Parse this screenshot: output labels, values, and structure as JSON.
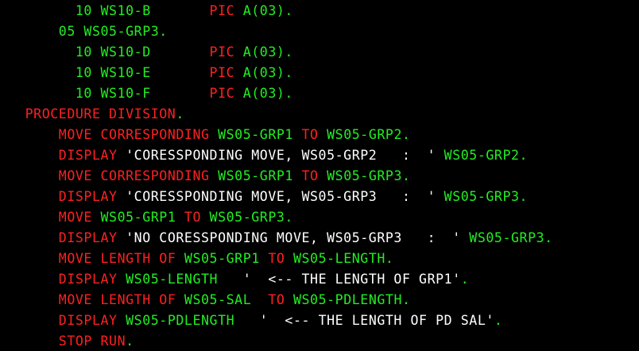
{
  "colors": {
    "background": "#000000",
    "keyword": "#ff2020",
    "identifier": "#22ee22",
    "literal": "#ffffff"
  },
  "lines": [
    {
      "indent": "         ",
      "tokens": [
        {
          "t": "10 WS10-B",
          "c": "id"
        },
        {
          "t": "       ",
          "c": "id"
        },
        {
          "t": "PIC",
          "c": "kw"
        },
        {
          "t": " ",
          "c": "id"
        },
        {
          "t": "A(03).",
          "c": "id"
        }
      ]
    },
    {
      "indent": "       ",
      "tokens": [
        {
          "t": "05 WS05-GRP3.",
          "c": "id"
        }
      ]
    },
    {
      "indent": "         ",
      "tokens": [
        {
          "t": "10 WS10-D",
          "c": "id"
        },
        {
          "t": "       ",
          "c": "id"
        },
        {
          "t": "PIC",
          "c": "kw"
        },
        {
          "t": " ",
          "c": "id"
        },
        {
          "t": "A(03).",
          "c": "id"
        }
      ]
    },
    {
      "indent": "         ",
      "tokens": [
        {
          "t": "10 WS10-E",
          "c": "id"
        },
        {
          "t": "       ",
          "c": "id"
        },
        {
          "t": "PIC",
          "c": "kw"
        },
        {
          "t": " ",
          "c": "id"
        },
        {
          "t": "A(03).",
          "c": "id"
        }
      ]
    },
    {
      "indent": "         ",
      "tokens": [
        {
          "t": "10 WS10-F",
          "c": "id"
        },
        {
          "t": "       ",
          "c": "id"
        },
        {
          "t": "PIC",
          "c": "kw"
        },
        {
          "t": " ",
          "c": "id"
        },
        {
          "t": "A(03).",
          "c": "id"
        }
      ]
    },
    {
      "indent": "   ",
      "tokens": [
        {
          "t": "PROCEDURE DIVISION",
          "c": "kw"
        },
        {
          "t": ".",
          "c": "id"
        }
      ]
    },
    {
      "indent": "       ",
      "tokens": [
        {
          "t": "MOVE CORRESPONDING",
          "c": "kw"
        },
        {
          "t": " WS05-GRP1 ",
          "c": "id"
        },
        {
          "t": "TO",
          "c": "kw"
        },
        {
          "t": " WS05-GRP2.",
          "c": "id"
        }
      ]
    },
    {
      "indent": "       ",
      "tokens": [
        {
          "t": "DISPLAY",
          "c": "kw"
        },
        {
          "t": " 'CORESSPONDING MOVE, WS05-GRP2   :  '",
          "c": "str"
        },
        {
          "t": " WS05-GRP2.",
          "c": "id"
        }
      ]
    },
    {
      "indent": "       ",
      "tokens": [
        {
          "t": "MOVE CORRESPONDING",
          "c": "kw"
        },
        {
          "t": " WS05-GRP1 ",
          "c": "id"
        },
        {
          "t": "TO",
          "c": "kw"
        },
        {
          "t": " WS05-GRP3.",
          "c": "id"
        }
      ]
    },
    {
      "indent": "       ",
      "tokens": [
        {
          "t": "DISPLAY",
          "c": "kw"
        },
        {
          "t": " 'CORESSPONDING MOVE, WS05-GRP3   :  '",
          "c": "str"
        },
        {
          "t": " WS05-GRP3.",
          "c": "id"
        }
      ]
    },
    {
      "indent": "       ",
      "tokens": [
        {
          "t": "MOVE",
          "c": "kw"
        },
        {
          "t": " WS05-GRP1 ",
          "c": "id"
        },
        {
          "t": "TO",
          "c": "kw"
        },
        {
          "t": " WS05-GRP3.",
          "c": "id"
        }
      ]
    },
    {
      "indent": "       ",
      "tokens": [
        {
          "t": "DISPLAY",
          "c": "kw"
        },
        {
          "t": " 'NO CORESSPONDING MOVE, WS05-GRP3   :  '",
          "c": "str"
        },
        {
          "t": " WS05-GRP3.",
          "c": "id"
        }
      ]
    },
    {
      "indent": "       ",
      "tokens": [
        {
          "t": "MOVE LENGTH OF",
          "c": "kw"
        },
        {
          "t": " WS05-GRP1 ",
          "c": "id"
        },
        {
          "t": "TO",
          "c": "kw"
        },
        {
          "t": " WS05-LENGTH.",
          "c": "id"
        }
      ]
    },
    {
      "indent": "       ",
      "tokens": [
        {
          "t": "DISPLAY",
          "c": "kw"
        },
        {
          "t": " WS05-LENGTH  ",
          "c": "id"
        },
        {
          "t": " '  <-- THE LENGTH OF GRP1'",
          "c": "str"
        },
        {
          "t": ".",
          "c": "id"
        }
      ]
    },
    {
      "indent": "       ",
      "tokens": [
        {
          "t": "MOVE LENGTH OF",
          "c": "kw"
        },
        {
          "t": " WS05-SAL  ",
          "c": "id"
        },
        {
          "t": "TO",
          "c": "kw"
        },
        {
          "t": " WS05-PDLENGTH.",
          "c": "id"
        }
      ]
    },
    {
      "indent": "       ",
      "tokens": [
        {
          "t": "DISPLAY",
          "c": "kw"
        },
        {
          "t": " WS05-PDLENGTH  ",
          "c": "id"
        },
        {
          "t": " '  <-- THE LENGTH OF PD SAL'",
          "c": "str"
        },
        {
          "t": ".",
          "c": "id"
        }
      ]
    },
    {
      "indent": "       ",
      "tokens": [
        {
          "t": "STOP RUN",
          "c": "kw"
        },
        {
          "t": ".",
          "c": "id"
        }
      ]
    }
  ]
}
